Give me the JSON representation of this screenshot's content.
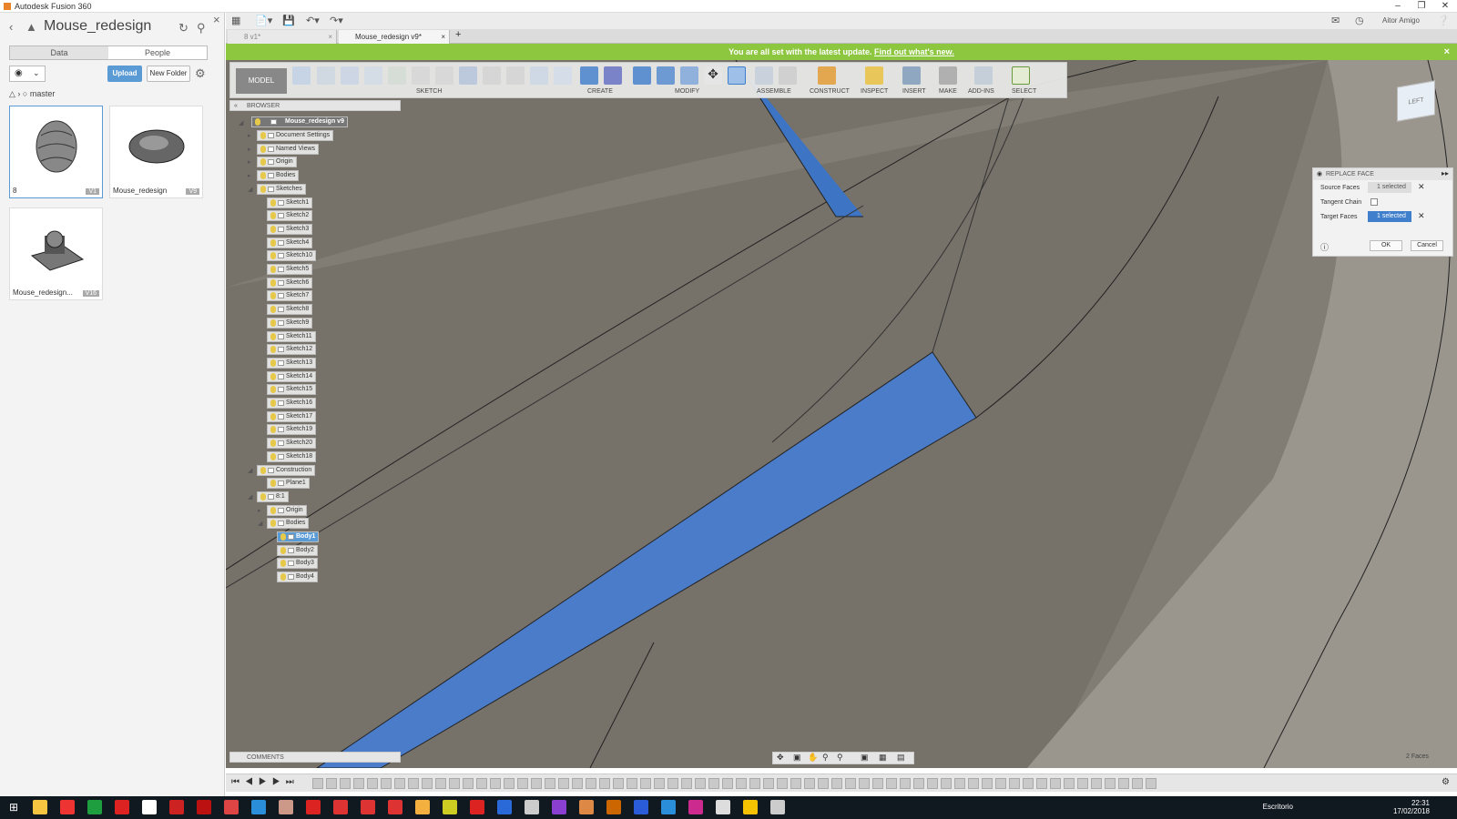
{
  "window": {
    "title": "Autodesk Fusion 360"
  },
  "data_panel": {
    "title": "Mouse_redesign",
    "tabs": [
      "Data",
      "People"
    ],
    "upload": "Upload",
    "new_folder": "New Folder",
    "branch": "master",
    "files": [
      {
        "name": "8",
        "version": "V1"
      },
      {
        "name": "Mouse_redesign",
        "version": "V9"
      },
      {
        "name": "Mouse_redesign...",
        "version": "V16"
      }
    ]
  },
  "doc_tabs": [
    {
      "label": "8 v1*"
    },
    {
      "label": "Mouse_redesign v9*"
    }
  ],
  "user": "Aitor Amigo",
  "banner": {
    "text": "You are all set with the latest update.",
    "link": "Find out what's new."
  },
  "toolbar": {
    "mode": "MODEL",
    "groups": [
      "SKETCH",
      "CREATE",
      "MODIFY",
      "ASSEMBLE",
      "CONSTRUCT",
      "INSPECT",
      "INSERT",
      "MAKE",
      "ADD-INS",
      "SELECT"
    ]
  },
  "browser": {
    "label": "BROWSER",
    "root": "Mouse_redesign v9",
    "nodes": [
      "Document Settings",
      "Named Views",
      "Origin",
      "Bodies",
      "Sketches",
      "Sketch1",
      "Sketch2",
      "Sketch3",
      "Sketch4",
      "Sketch10",
      "Sketch5",
      "Sketch6",
      "Sketch7",
      "Sketch8",
      "Sketch9",
      "Sketch11",
      "Sketch12",
      "Sketch13",
      "Sketch14",
      "Sketch15",
      "Sketch16",
      "Sketch17",
      "Sketch19",
      "Sketch20",
      "Sketch18",
      "Construction",
      "Plane1",
      "8:1",
      "Origin",
      "Bodies",
      "Body1",
      "Body2",
      "Body3",
      "Body4"
    ]
  },
  "replace_face": {
    "title": "REPLACE FACE",
    "source_label": "Source Faces",
    "source_value": "1 selected",
    "tangent_label": "Tangent Chain",
    "target_label": "Target Faces",
    "target_value": "1 selected",
    "ok": "OK",
    "cancel": "Cancel"
  },
  "viewcube": {
    "face": "LEFT"
  },
  "comments": {
    "label": "COMMENTS"
  },
  "status": "2 Faces",
  "taskbar": {
    "desktop": "Escritorio",
    "time": "22:31",
    "date": "17/02/2018"
  }
}
